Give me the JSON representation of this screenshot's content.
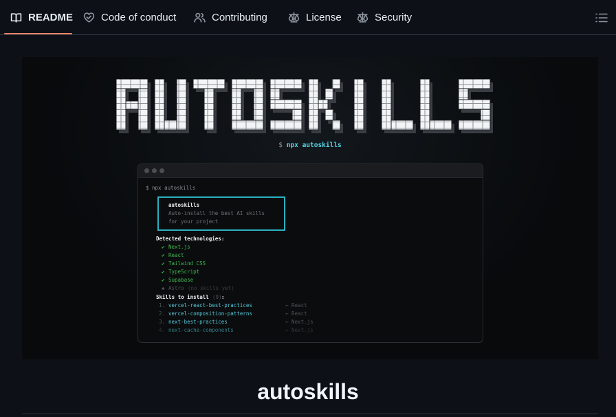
{
  "tabs": [
    {
      "label": "README",
      "icon": "book-icon",
      "active": true
    },
    {
      "label": "Code of conduct",
      "icon": "code-of-conduct-icon",
      "active": false
    },
    {
      "label": "Contributing",
      "icon": "people-icon",
      "active": false
    },
    {
      "label": "License",
      "icon": "law-icon",
      "active": false
    },
    {
      "label": "Security",
      "icon": "law-icon",
      "active": false
    }
  ],
  "accent_color": "#f78166",
  "hero": {
    "logo_text": "AUTOSKILLS",
    "prompt": "$ ",
    "command": "npx autoskills",
    "terminal": {
      "prompt_line": "$ npx autoskills",
      "box_title": "autoskills",
      "box_line1": "Auto-install the best AI skills",
      "box_line2": "for your project",
      "detected_heading": "Detected technologies:",
      "check": "✔",
      "technologies": [
        "Next.js",
        "React",
        "Tailwind CSS",
        "TypeScript",
        "Supabase"
      ],
      "skipped": {
        "bullet": "◆",
        "name": "Astro",
        "note": "(no skills yet)"
      },
      "skills_heading": "Skills to install",
      "skills_count": "(9)",
      "skills_colon": ":",
      "skills": [
        {
          "num": "1.",
          "name": "vercel-react-best-practices",
          "source": "← React"
        },
        {
          "num": "2.",
          "name": "vercel-composition-patterns",
          "source": "← React"
        },
        {
          "num": "3.",
          "name": "next-best-practices",
          "source": "← Next.js"
        },
        {
          "num": "4.",
          "name": "next-cache-components",
          "source": "← Next.js"
        }
      ]
    }
  },
  "readme_title": "autoskills"
}
